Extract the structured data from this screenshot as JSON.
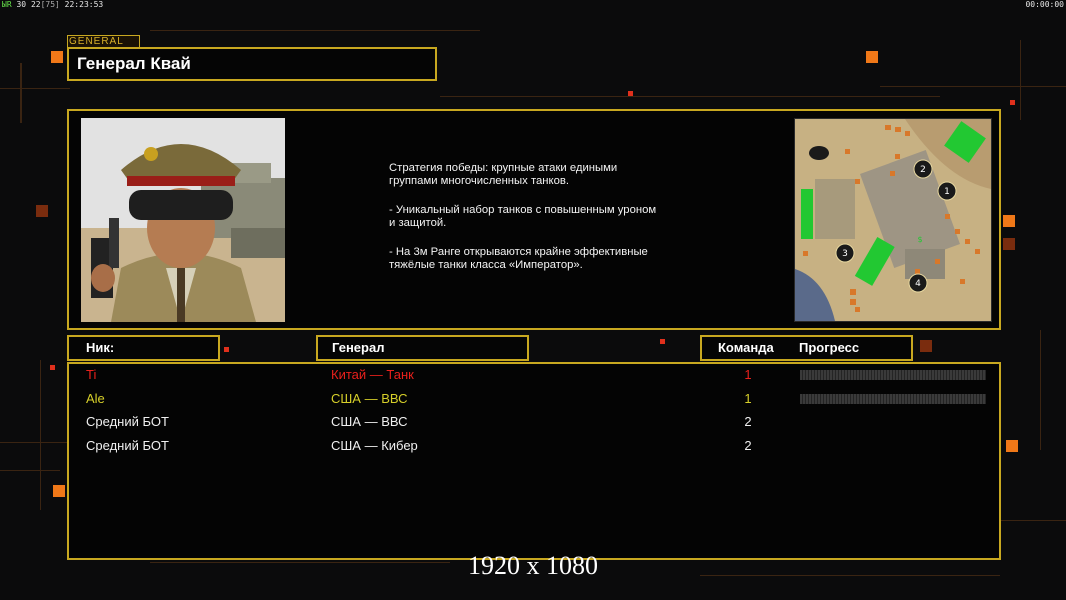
{
  "hud": {
    "fps_label": "ЫR",
    "fps_value": "30",
    "latency": "22",
    "latency_bracket": "[75]",
    "clock": "22:23:53",
    "game_timer": "00:00:00"
  },
  "general": {
    "tab_label": "GENERAL",
    "name": "Генерал Квай",
    "description": [
      "Стратегия победы: крупные атаки едиными\n группами многочисленных танков.",
      "- Уникальный набор танков с повышенным уроном\n и защитой.",
      "- На 3м Ранге открываются крайне эффективные\n тяжёлые танки класса «Император»."
    ]
  },
  "minimap": {
    "start_positions": [
      "1",
      "2",
      "3",
      "4"
    ],
    "supply_icon": "$"
  },
  "table": {
    "headers": {
      "nick": "Ник:",
      "general": "Генерал",
      "team": "Команда",
      "progress": "Прогресс"
    },
    "rows": [
      {
        "nick": "Ti",
        "general": "Китай — Танк",
        "team": "1",
        "color": "#e8201c",
        "progress": 0
      },
      {
        "nick": "Ale",
        "general": "США — ВВС",
        "team": "1",
        "color": "#d6cf2a",
        "progress": 0
      },
      {
        "nick": "Средний БОТ",
        "general": "США — ВВС",
        "team": "2",
        "color": "#f0f0f0",
        "progress": null
      },
      {
        "nick": "Средний БОТ",
        "general": "США — Кибер",
        "team": "2",
        "color": "#f0f0f0",
        "progress": null
      }
    ]
  },
  "resolution_caption": "1920 x 1080",
  "colors": {
    "frame": "#c8a820",
    "accent_orange": "#f07818"
  }
}
